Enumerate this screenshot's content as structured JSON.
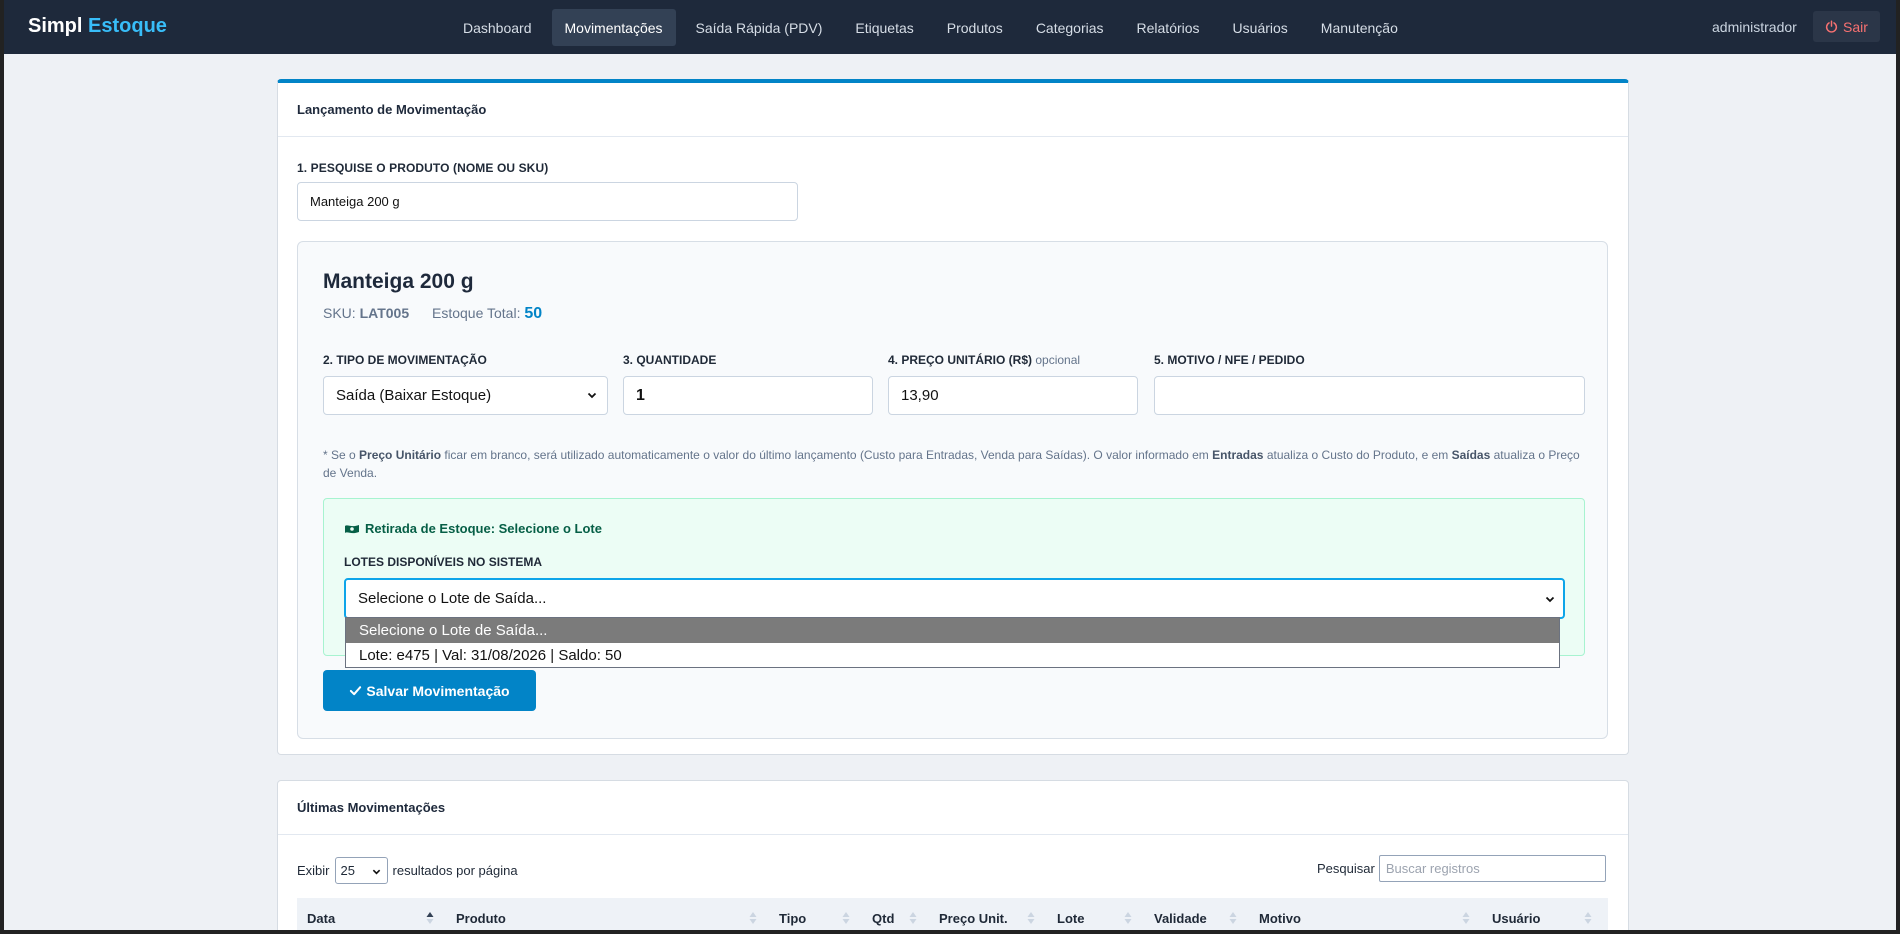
{
  "brand": {
    "name": "Simpl",
    "accent": "Estoque"
  },
  "nav": {
    "items": [
      {
        "label": "Dashboard",
        "active": false
      },
      {
        "label": "Movimentações",
        "active": true
      },
      {
        "label": "Saída Rápida (PDV)",
        "active": false
      },
      {
        "label": "Etiquetas",
        "active": false
      },
      {
        "label": "Produtos",
        "active": false
      },
      {
        "label": "Categorias",
        "active": false
      },
      {
        "label": "Relatórios",
        "active": false
      },
      {
        "label": "Usuários",
        "active": false
      },
      {
        "label": "Manutenção",
        "active": false
      }
    ],
    "user": "administrador",
    "logout": "Sair"
  },
  "form": {
    "title": "Lançamento de Movimentação",
    "search_label": "1. PESQUISE O PRODUTO (NOME OU SKU)",
    "search_value": "Manteiga 200 g",
    "product": {
      "name": "Manteiga 200 g",
      "sku_label": "SKU:",
      "sku": "LAT005",
      "stock_label": "Estoque Total:",
      "stock": "50"
    },
    "type_label": "2. TIPO DE MOVIMENTAÇÃO",
    "type_value": "Saída (Baixar Estoque)",
    "qty_label": "3. QUANTIDADE",
    "qty_value": "1",
    "price_label": "4. PREÇO UNITÁRIO (R$)",
    "price_optional": "opcional",
    "price_value": "13,90",
    "reason_label": "5. MOTIVO / NFE / PEDIDO",
    "reason_value": "",
    "hint": {
      "p1": "* Se o ",
      "b1": "Preço Unitário",
      "p2": " ficar em branco, será utilizado automaticamente o valor do último lançamento (Custo para Entradas, Venda para Saídas). O valor informado em ",
      "b2": "Entradas",
      "p3": " atualiza o Custo do Produto, e em ",
      "b3": "Saídas",
      "p4": " atualiza o Preço de Venda."
    },
    "lot": {
      "title": "Retirada de Estoque: Selecione o Lote",
      "label": "LOTES DISPONÍVEIS NO SISTEMA",
      "selected": "Selecione o Lote de Saída...",
      "options": [
        "Selecione o Lote de Saída...",
        "Lote: e475 | Val: 31/08/2026 | Saldo: 50"
      ]
    },
    "save_label": "Salvar Movimentação"
  },
  "history": {
    "title": "Últimas Movimentações",
    "show_label": "Exibir",
    "page_size": "25",
    "per_page_label": "resultados por página",
    "search_label": "Pesquisar",
    "search_placeholder": "Buscar registros",
    "columns": [
      "Data",
      "Produto",
      "Tipo",
      "Qtd",
      "Preço Unit.",
      "Lote",
      "Validade",
      "Motivo",
      "Usuário"
    ]
  },
  "colors": {
    "navbar": "#1e293b",
    "accent": "#0284c7",
    "brand_accent": "#38bdf8",
    "logout": "#f87171",
    "lot_bg": "#ecfdf5"
  }
}
